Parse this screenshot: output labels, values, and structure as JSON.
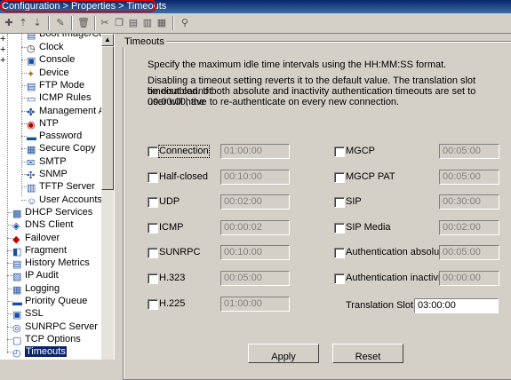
{
  "breadcrumb": "Configuration > Properties > Timeouts",
  "toolbar_icons": [
    "add-icon",
    "move-up-icon",
    "move-down-icon",
    "edit-icon",
    "delete-icon",
    "cut-icon",
    "copy-icon",
    "paste-icon",
    "paste-special-icon",
    "find-icon"
  ],
  "tree": [
    {
      "label": "Clock",
      "icon": "clock-icon"
    },
    {
      "label": "Console",
      "icon": "console-icon"
    },
    {
      "label": "Device",
      "icon": "device-icon"
    },
    {
      "label": "FTP Mode",
      "icon": "ftp-icon"
    },
    {
      "label": "ICMP Rules",
      "icon": "icmp-icon"
    },
    {
      "label": "Management Ac",
      "icon": "management-icon"
    },
    {
      "label": "NTP",
      "icon": "ntp-icon"
    },
    {
      "label": "Password",
      "icon": "password-icon"
    },
    {
      "label": "Secure Copy",
      "icon": "secure-copy-icon"
    },
    {
      "label": "SMTP",
      "icon": "smtp-icon"
    },
    {
      "label": "SNMP",
      "icon": "snmp-icon"
    },
    {
      "label": "TFTP Server",
      "icon": "tftp-icon"
    },
    {
      "label": "User Accounts",
      "icon": "user-accounts-icon"
    },
    {
      "label": "DHCP Services",
      "icon": "dhcp-icon",
      "expandable": true
    },
    {
      "label": "DNS Client",
      "icon": "dns-icon"
    },
    {
      "label": "Failover",
      "icon": "failover-icon"
    },
    {
      "label": "Fragment",
      "icon": "fragment-icon"
    },
    {
      "label": "History Metrics",
      "icon": "history-icon"
    },
    {
      "label": "IP Audit",
      "icon": "ip-audit-icon",
      "expandable": true
    },
    {
      "label": "Logging",
      "icon": "logging-icon",
      "expandable": true
    },
    {
      "label": "Priority Queue",
      "icon": "priority-queue-icon"
    },
    {
      "label": "SSL",
      "icon": "ssl-icon"
    },
    {
      "label": "SUNRPC Server",
      "icon": "sunrpc-icon"
    },
    {
      "label": "TCP Options",
      "icon": "tcp-icon"
    },
    {
      "label": "Timeouts",
      "icon": "timeouts-icon",
      "selected": true
    }
  ],
  "group_title": "Timeouts",
  "desc1": "Specify the maximum idle time intervals using the HH:MM:SS format.",
  "desc2": [
    "Disabling a timeout setting reverts it to the default value. The translation slot timeout cannot",
    "be disabled.  If both absolute and inactivity authentication timeouts are set to 00:00:00, the",
    "user will have to re-authenticate on every new connection."
  ],
  "left_col": [
    {
      "label": "Connection",
      "value": "01:00:00",
      "checked": false
    },
    {
      "label": "Half-closed",
      "value": "00:10:00",
      "checked": false
    },
    {
      "label": "UDP",
      "value": "00:02:00",
      "checked": false
    },
    {
      "label": "ICMP",
      "value": "00:00:02",
      "checked": false
    },
    {
      "label": "SUNRPC",
      "value": "00:10:00",
      "checked": false
    },
    {
      "label": "H.323",
      "value": "00:05:00",
      "checked": false
    },
    {
      "label": "H.225",
      "value": "01:00:00",
      "checked": false
    }
  ],
  "right_col": [
    {
      "label": "MGCP",
      "value": "00:05:00",
      "checked": false
    },
    {
      "label": "MGCP PAT",
      "value": "00:05:00",
      "checked": false
    },
    {
      "label": "SIP",
      "value": "00:30:00",
      "checked": false
    },
    {
      "label": "SIP Media",
      "value": "00:02:00",
      "checked": false
    },
    {
      "label": "Authentication absolute",
      "value": "00:05:00",
      "checked": false
    },
    {
      "label": "Authentication inactivity",
      "value": "00:00:00",
      "checked": false
    }
  ],
  "translation_slot": {
    "label": "Translation Slot:",
    "value": "03:00:00"
  },
  "buttons": {
    "apply": "Apply",
    "reset": "Reset"
  },
  "colors": {
    "selection": "#0a246a",
    "breadcrumb_highlight": "#e00000",
    "window": "#d4d0c8"
  }
}
